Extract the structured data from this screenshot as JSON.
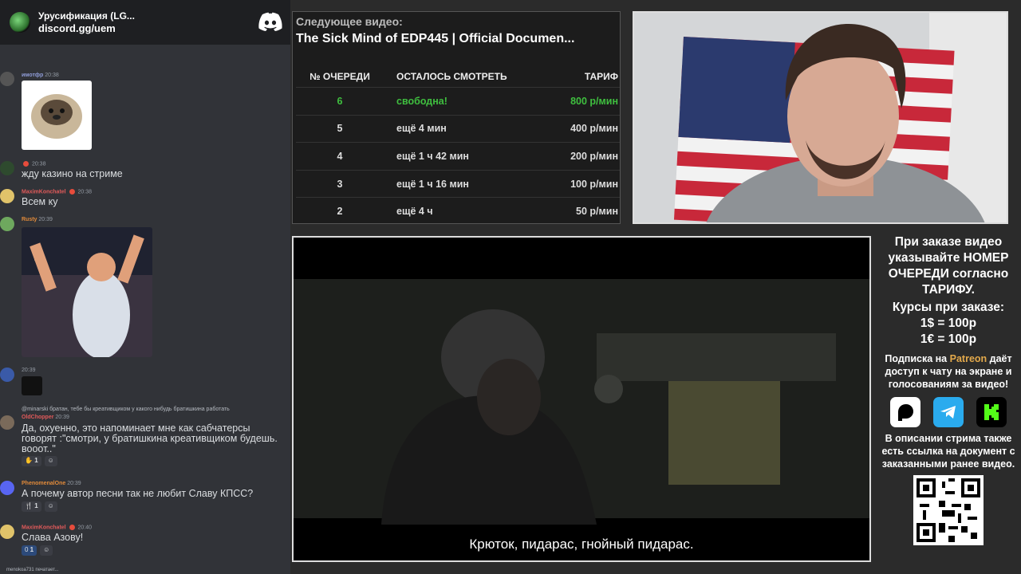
{
  "discord": {
    "server_name": "Урусификация (LG...",
    "invite": "discord.gg/uem",
    "messages": [
      {
        "author": "имотфр",
        "time": "20:38",
        "text": ""
      },
      {
        "author": "",
        "time": "20:38",
        "text": "жду казино на стриме"
      },
      {
        "author": "MaximKonchatel",
        "time": "20:38",
        "text": "Всем ку"
      },
      {
        "author": "Rusty",
        "time": "20:39",
        "text": ""
      },
      {
        "author": "",
        "time": "20:39",
        "text": ""
      },
      {
        "author": "OldChopper",
        "time": "20:39",
        "reply": "@minarski братан, тебе бы креативщиком у какого нибудь братишкина работать",
        "text": "Да, охуенно, это напоминает мне как сабчатерсы говорят :\"смотри, у братишкина креативщиком будешь. вооот..\"",
        "reaction": "1"
      },
      {
        "author": "PhenomenalOne",
        "time": "20:39",
        "text": "А почему автор песни так не любит Славу КПСС?",
        "reaction": "1"
      },
      {
        "author": "MaximKonchatel",
        "time": "20:40",
        "text": "Слава Азову!",
        "reaction": "1"
      }
    ],
    "typing": "menokoa731 печатает..."
  },
  "queue": {
    "next_label": "Следующее видео:",
    "next_title": "The Sick Mind of EDP445 | Official Documen...",
    "headers": [
      "№ ОЧЕРЕДИ",
      "ОСТАЛОСЬ СМОТРЕТЬ",
      "ТАРИФ"
    ],
    "rows": [
      {
        "num": "6",
        "remaining": "свободна!",
        "rate": "800 р/мин",
        "active": true
      },
      {
        "num": "5",
        "remaining": "ещё 4 мин",
        "rate": "400 р/мин",
        "active": false
      },
      {
        "num": "4",
        "remaining": "ещё 1 ч 42 мин",
        "rate": "200 р/мин",
        "active": false
      },
      {
        "num": "3",
        "remaining": "ещё 1 ч 16 мин",
        "rate": "100 р/мин",
        "active": false
      },
      {
        "num": "2",
        "remaining": "ещё 4 ч",
        "rate": "50 р/мин",
        "active": false
      }
    ]
  },
  "video": {
    "subtitle": "Крюток, пидарас, гнойный пидарас."
  },
  "info": {
    "order_note": "При заказе видео указывайте НОМЕР ОЧЕРЕДИ согласно ТАРИФУ.",
    "rates_title": "Курсы при заказе:",
    "rate_usd": "1$ = 100р",
    "rate_eur": "1€ = 100р",
    "sub_prefix": "Подписка на",
    "sub_brand": "Patreon",
    "sub_suffix": "даёт доступ к чату на экране и голосованиям за видео!",
    "description_note": "В описании стрима также есть ссылка на документ с заказанными ранее видео.",
    "socials": [
      "patreon-icon",
      "telegram-icon",
      "kick-icon"
    ]
  },
  "colors": {
    "discord_bg": "#313338",
    "green_active": "#3fbf3f",
    "patreon": "#e3a94b",
    "telegram": "#2aabee",
    "kick": "#53fc18"
  }
}
